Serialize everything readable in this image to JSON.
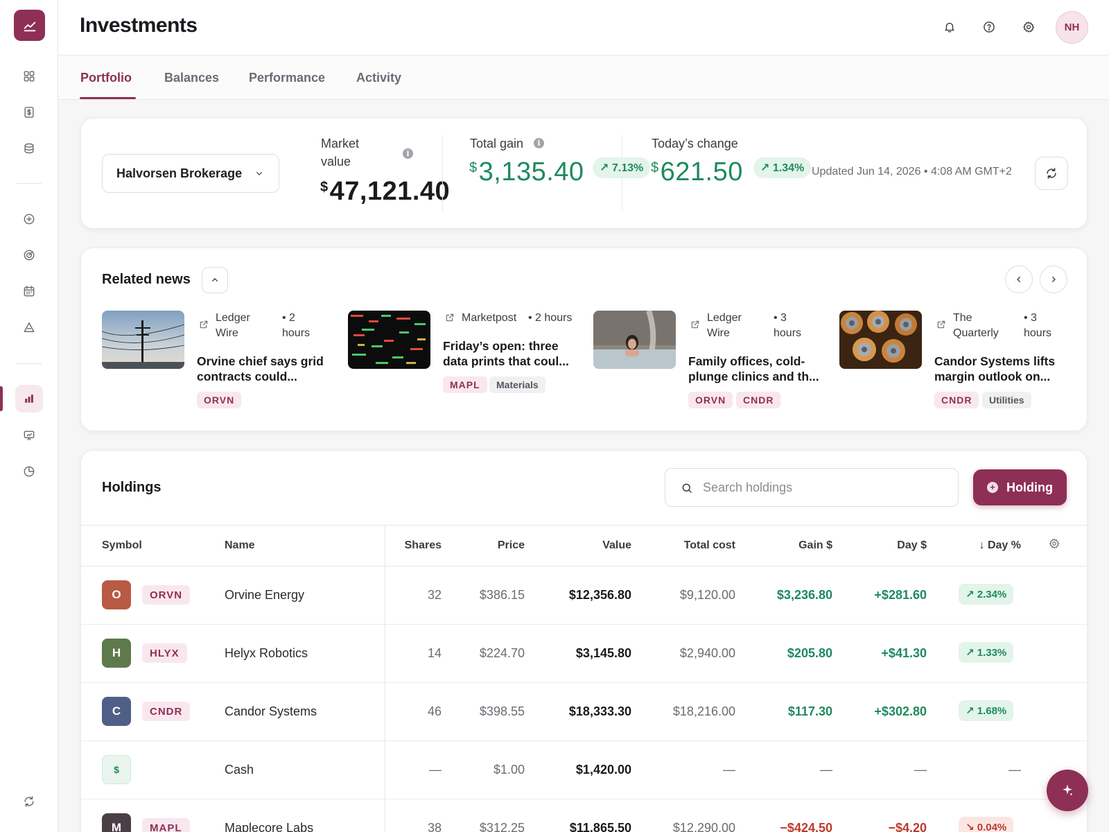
{
  "app": {
    "title": "Investments"
  },
  "header": {
    "avatar_initials": "NH"
  },
  "tabs": [
    {
      "label": "Portfolio",
      "active": true
    },
    {
      "label": "Balances",
      "active": false
    },
    {
      "label": "Performance",
      "active": false
    },
    {
      "label": "Activity",
      "active": false
    }
  ],
  "summary": {
    "account": "Halvorsen Brokerage",
    "market_value": {
      "label_line1": "Market",
      "label_line2": "value",
      "currency": "$",
      "amount": "47,121.40"
    },
    "total_gain": {
      "label": "Total gain",
      "currency": "$",
      "amount": "3,135.40",
      "pct": "↗ 7.13%"
    },
    "todays_change": {
      "label": "Today’s change",
      "currency": "$",
      "amount": "621.50",
      "pct": "↗ 1.34%"
    },
    "updated": "Updated Jun 14, 2026 • 4:08 AM GMT+2"
  },
  "news": {
    "title": "Related news",
    "items": [
      {
        "source_a": "Ledger",
        "source_b": "Wire",
        "time_a": "• 2",
        "time_b": "hours",
        "headline_1": "Orvine chief says grid",
        "headline_2": "contracts could...",
        "tags": [
          "ORVN"
        ]
      },
      {
        "source_a": "Marketpost",
        "time_a": "• 2 hours",
        "headline_1": "Friday’s open: three",
        "headline_2": "data prints that coul...",
        "tags": [
          "MAPL",
          "Materials"
        ]
      },
      {
        "source_a": "Ledger",
        "source_b": "Wire",
        "time_a": "• 3",
        "time_b": "hours",
        "headline_1": "Family offices, cold-",
        "headline_2": "plunge clinics and th...",
        "tags": [
          "ORVN",
          "CNDR"
        ]
      },
      {
        "source_a": "The",
        "source_b": "Quarterly",
        "time_a": "• 3",
        "time_b": "hours",
        "headline_1": "Candor Systems lifts",
        "headline_2": "margin outlook on...",
        "tags": [
          "CNDR",
          "Utilities"
        ]
      }
    ]
  },
  "holdings": {
    "title": "Holdings",
    "search_placeholder": "Search holdings",
    "add_button": "Holding",
    "columns": {
      "symbol": "Symbol",
      "name": "Name",
      "shares": "Shares",
      "price": "Price",
      "value": "Value",
      "total_cost": "Total cost",
      "gain": "Gain $",
      "day": "Day $",
      "day_pct": "↓ Day %"
    },
    "rows": [
      {
        "initial": "O",
        "color": "#b85a44",
        "ticker": "ORVN",
        "name": "Orvine Energy",
        "shares": "32",
        "price": "$386.15",
        "value": "$12,356.80",
        "cost": "$9,120.00",
        "gain": "$3,236.80",
        "day": "+$281.60",
        "pct": "↗ 2.34%",
        "trend": "up"
      },
      {
        "initial": "H",
        "color": "#5e7a4c",
        "ticker": "HLYX",
        "name": "Helyx Robotics",
        "shares": "14",
        "price": "$224.70",
        "value": "$3,145.80",
        "cost": "$2,940.00",
        "gain": "$205.80",
        "day": "+$41.30",
        "pct": "↗ 1.33%",
        "trend": "up"
      },
      {
        "initial": "C",
        "color": "#4f5f86",
        "ticker": "CNDR",
        "name": "Candor Systems",
        "shares": "46",
        "price": "$398.55",
        "value": "$18,333.30",
        "cost": "$18,216.00",
        "gain": "$117.30",
        "day": "+$302.80",
        "pct": "↗ 1.68%",
        "trend": "up"
      },
      {
        "initial": "$",
        "color": "#e3f4ea",
        "ticker": "",
        "name": "Cash",
        "shares": "—",
        "price": "$1.00",
        "value": "$1,420.00",
        "cost": "—",
        "gain": "—",
        "day": "—",
        "pct": "—",
        "trend": "none"
      },
      {
        "initial": "M",
        "color": "#4a3f45",
        "ticker": "MAPL",
        "name": "Maplecore Labs",
        "shares": "38",
        "price": "$312.25",
        "value": "$11,865.50",
        "cost": "$12,290.00",
        "gain": "−$424.50",
        "day": "−$4.20",
        "pct": "↘ 0.04%",
        "trend": "down"
      }
    ]
  }
}
